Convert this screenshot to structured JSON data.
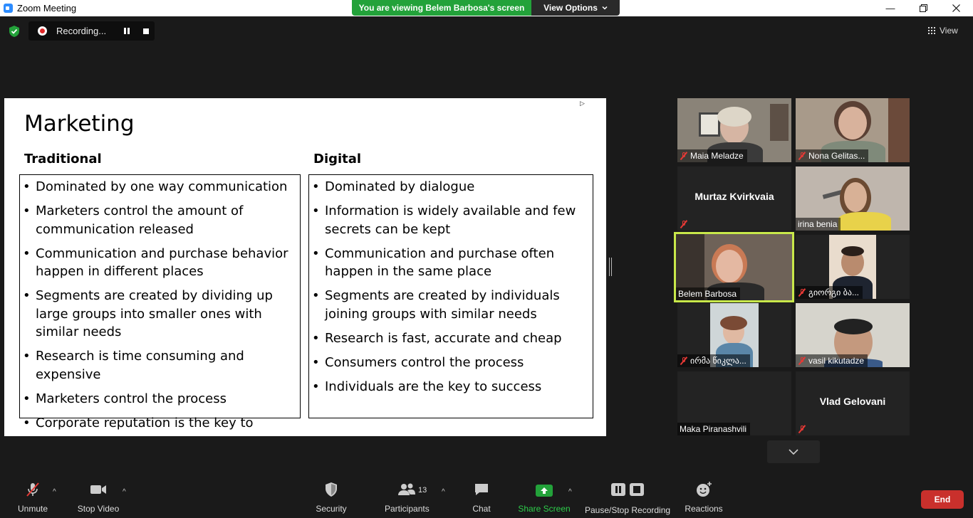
{
  "window": {
    "title": "Zoom Meeting"
  },
  "banner": {
    "viewing": "You are viewing Belem Barbosa's screen",
    "view_options": "View Options"
  },
  "recording": {
    "label": "Recording..."
  },
  "view": {
    "label": "View"
  },
  "slide": {
    "title": "Marketing",
    "traditional": {
      "heading": "Traditional",
      "bullets": [
        "Dominated by one way communication",
        "Marketers control the amount of communication released",
        "Communication and purchase behavior happen in different places",
        "Segments are created by dividing up large groups into smaller ones with similar needs",
        "Research is time consuming and expensive",
        "Marketers control the process",
        "Corporate reputation is the key to success"
      ]
    },
    "digital": {
      "heading": "Digital",
      "bullets": [
        "Dominated by dialogue",
        "Information is widely available and few secrets can be kept",
        "Communication and purchase often happen in the same place",
        "Segments are created by individuals joining groups with similar needs",
        "Research is fast, accurate and cheap",
        "Consumers control the process",
        "Individuals are the key to success"
      ]
    }
  },
  "participants": [
    {
      "name": "Maia Meladze",
      "muted": true
    },
    {
      "name": "Nona Gelitas...",
      "muted": true
    },
    {
      "name": "Murtaz Kvirkvaia",
      "muted": true
    },
    {
      "name": "irina benia",
      "muted": false
    },
    {
      "name": "Belem Barbosa",
      "muted": false,
      "active": true
    },
    {
      "name": "გიორგი ბა...",
      "muted": true
    },
    {
      "name": "ირმა წიკლა...",
      "muted": true
    },
    {
      "name": "vasil kikutadze",
      "muted": true
    },
    {
      "name": "Maka Piranashvili",
      "muted": false
    },
    {
      "name": "Vlad Gelovani",
      "muted": true
    }
  ],
  "toolbar": {
    "unmute": "Unmute",
    "stop_video": "Stop Video",
    "security": "Security",
    "participants": "Participants",
    "participants_count": "13",
    "chat": "Chat",
    "share_screen": "Share Screen",
    "pause_stop_recording": "Pause/Stop Recording",
    "reactions": "Reactions",
    "end": "End"
  },
  "colors": {
    "share_green": "#23a23a",
    "end_red": "#c9302c",
    "active_border": "#c8e84a",
    "mute_red": "#e53935"
  }
}
